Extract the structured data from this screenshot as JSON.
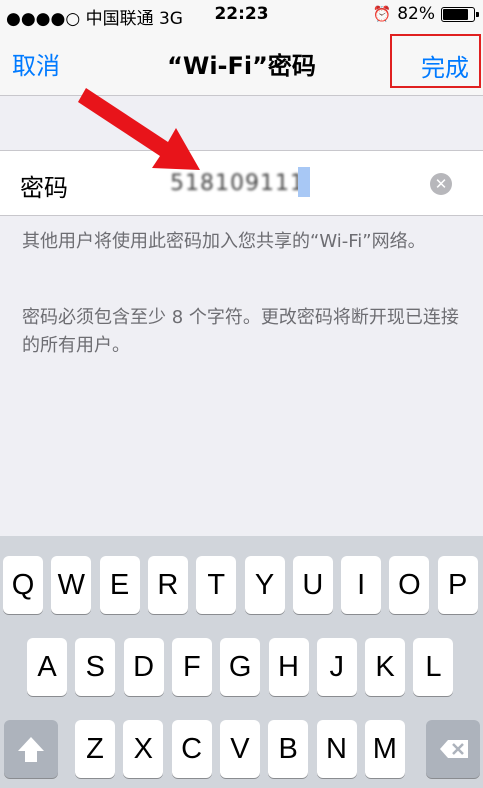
{
  "status_bar": {
    "carrier": "●●●●○ 中国联通  3G",
    "time": "22:23",
    "battery": "82%",
    "battery_level": 0.82
  },
  "nav": {
    "cancel_label": "取消",
    "title": "“Wi-Fi”密码",
    "done_label": "完成"
  },
  "password_field": {
    "label": "密码",
    "value": "518109111"
  },
  "notes": {
    "share_info": "其他用户将使用此密码加入您共享的“Wi-Fi”网络。",
    "requirement": "密码必须包含至少 8 个字符。更改密码将断开现已连接的所有用户。"
  },
  "keyboard": {
    "row1": [
      "Q",
      "W",
      "E",
      "R",
      "T",
      "Y",
      "U",
      "I",
      "O",
      "P"
    ],
    "row2": [
      "A",
      "S",
      "D",
      "F",
      "G",
      "H",
      "J",
      "K",
      "L"
    ],
    "row3": [
      "Z",
      "X",
      "C",
      "V",
      "B",
      "N",
      "M"
    ],
    "shift_icon": "shift-arrow",
    "delete_icon": "delete-backspace"
  },
  "colors": {
    "accent": "#007aff",
    "highlight_box": "#e02020",
    "arrow": "#e8141a"
  }
}
